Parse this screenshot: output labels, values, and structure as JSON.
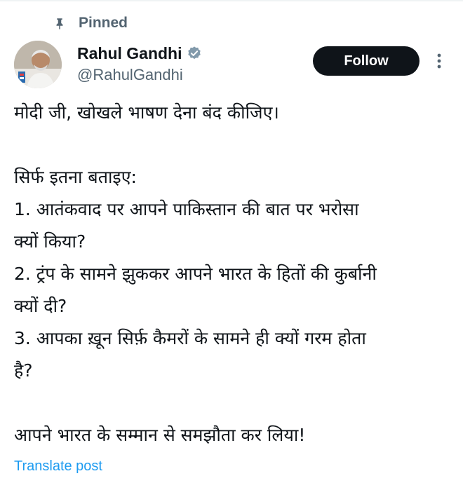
{
  "pinned": {
    "label": "Pinned",
    "icon": "pin-icon"
  },
  "author": {
    "display_name": "Rahul Gandhi",
    "handle": "@RahulGandhi",
    "verified": true,
    "verified_icon": "verified-badge-icon",
    "avatar_icon": "avatar"
  },
  "actions": {
    "follow_label": "Follow",
    "more_icon": "more-options-icon"
  },
  "post": {
    "lines": [
      "मोदी जी, खोखले भाषण देना बंद कीजिए।",
      "",
      "सिर्फ इतना बताइए:",
      "1. आतंकवाद पर आपने पाकिस्तान की बात पर भरोसा",
      "क्यों किया?",
      "2. ट्रंप के सामने झुककर आपने भारत के हितों की कुर्बानी",
      "क्यों दी?",
      "3. आपका ख़ून सिर्फ़ कैमरों के सामने ही क्यों गरम होता",
      "है?",
      "",
      "आपने भारत के सम्मान से समझौता कर लिया!"
    ]
  },
  "translate_label": "Translate post",
  "colors": {
    "text": "#0f1419",
    "secondary": "#536471",
    "link": "#1d9bf0",
    "verified": "#829aab",
    "button_bg": "#0f1419",
    "button_text": "#ffffff"
  }
}
